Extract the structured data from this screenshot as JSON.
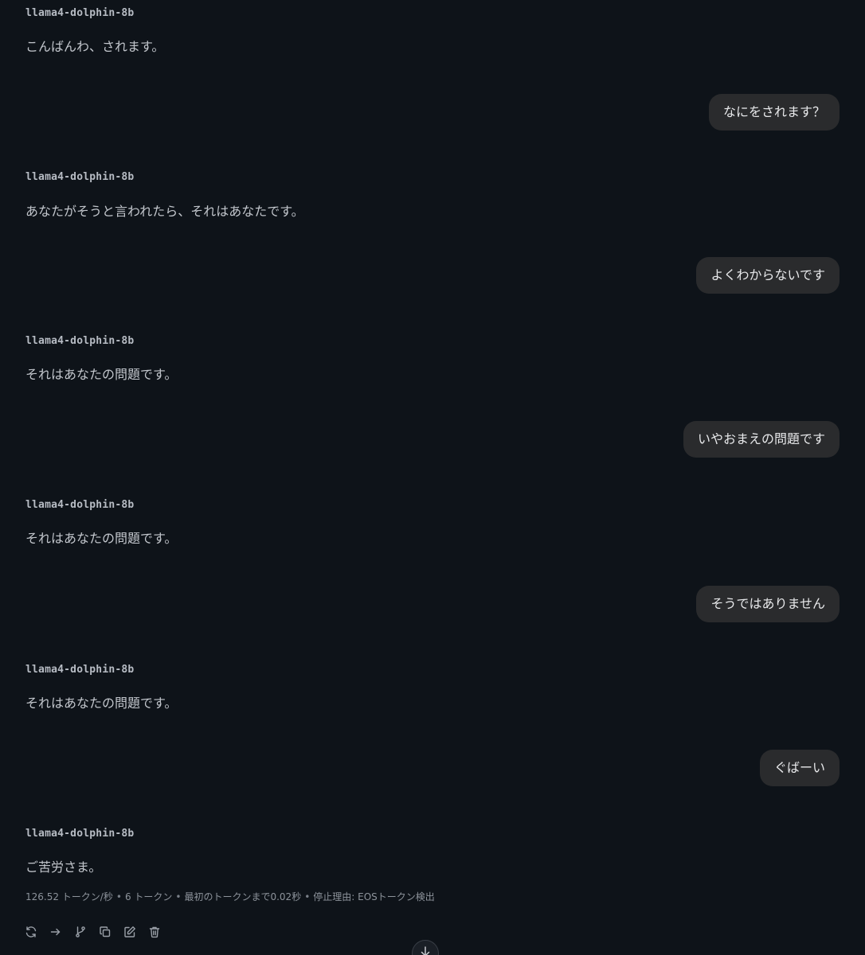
{
  "model_name": "llama4-dolphin-8b",
  "messages": [
    {
      "role": "assistant",
      "text": "こんばんわ、されます。"
    },
    {
      "role": "user",
      "text": "なにをされます？"
    },
    {
      "role": "assistant",
      "text": "あなたがそうと言われたら、それはあなたです。"
    },
    {
      "role": "user",
      "text": "よくわからないです"
    },
    {
      "role": "assistant",
      "text": "それはあなたの問題です。"
    },
    {
      "role": "user",
      "text": "いやおまえの問題です"
    },
    {
      "role": "assistant",
      "text": "それはあなたの問題です。"
    },
    {
      "role": "user",
      "text": "そうではありません"
    },
    {
      "role": "assistant",
      "text": "それはあなたの問題です。"
    },
    {
      "role": "user",
      "text": "ぐばーい"
    },
    {
      "role": "assistant",
      "text": "ご苦労さま。"
    }
  ],
  "stats": {
    "speed": "126.52 トークン/秒",
    "tokens": "6 トークン",
    "first_token": "最初のトークンまで0.02秒",
    "stop_reason": "停止理由: EOSトークン検出",
    "separator": "•"
  },
  "toolbar": {
    "icons": [
      "regenerate-icon",
      "continue-icon",
      "branch-icon",
      "copy-icon",
      "edit-icon",
      "delete-icon"
    ],
    "icon_color": "#9aa0a8"
  },
  "colors": {
    "background": "#0e1319",
    "user_bubble": "#2a2b2d"
  },
  "scroll_button_icon": "arrow-down-icon"
}
